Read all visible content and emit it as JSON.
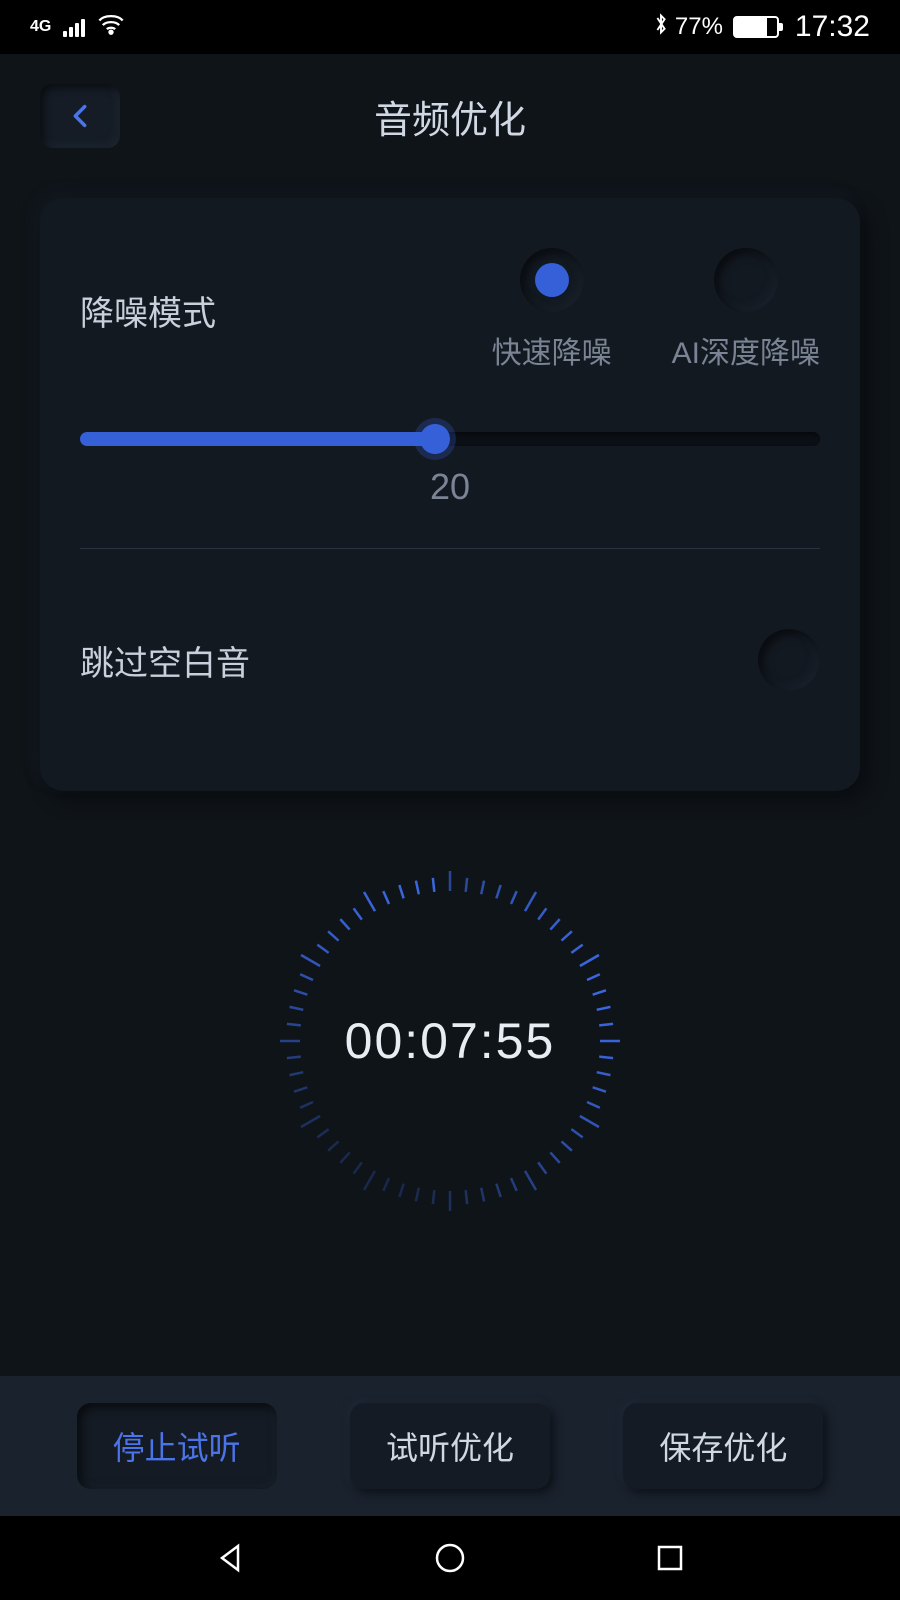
{
  "status_bar": {
    "network": "4G",
    "bluetooth": true,
    "battery_percent": "77%",
    "time": "17:32"
  },
  "header": {
    "title": "音频优化"
  },
  "noise_reduction": {
    "label": "降噪模式",
    "options": [
      {
        "label": "快速降噪",
        "selected": true
      },
      {
        "label": "AI深度降噪",
        "selected": false
      }
    ],
    "slider_value": "20"
  },
  "skip_silence": {
    "label": "跳过空白音",
    "enabled": false
  },
  "timer": {
    "value": "00:07:55"
  },
  "actions": {
    "stop_preview": "停止试听",
    "preview_optimize": "试听优化",
    "save_optimize": "保存优化"
  }
}
